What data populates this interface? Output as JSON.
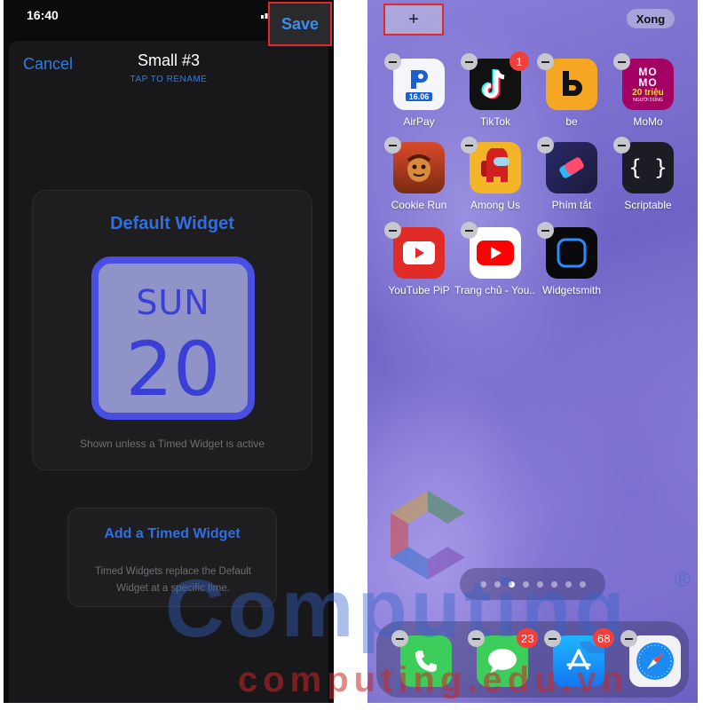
{
  "left": {
    "status": {
      "time": "16:40"
    },
    "nav": {
      "cancel": "Cancel",
      "title": "Small #3",
      "subtitle": "TAP TO RENAME",
      "save": "Save"
    },
    "default_card": {
      "title": "Default Widget",
      "day": "SUN",
      "date": "20",
      "caption": "Shown unless a Timed Widget is active"
    },
    "timed_card": {
      "title": "Add a Timed Widget",
      "description": "Timed Widgets replace the Default Widget at a specific time."
    }
  },
  "right": {
    "top": {
      "add": "+",
      "done": "Xong"
    },
    "apps": [
      {
        "label": "AirPay",
        "icon": "airpay-icon",
        "badge": ""
      },
      {
        "label": "TikTok",
        "icon": "tiktok-icon",
        "badge": "1"
      },
      {
        "label": "be",
        "icon": "be-icon",
        "badge": ""
      },
      {
        "label": "MoMo",
        "icon": "momo-icon",
        "badge": ""
      },
      {
        "label": "Cookie Run",
        "icon": "cookie-run-icon",
        "badge": ""
      },
      {
        "label": "Among Us",
        "icon": "among-us-icon",
        "badge": ""
      },
      {
        "label": "Phím tắt",
        "icon": "shortcuts-icon",
        "badge": ""
      },
      {
        "label": "Scriptable",
        "icon": "scriptable-icon",
        "badge": ""
      },
      {
        "label": "YouTube PiP",
        "icon": "youtube-pip-icon",
        "badge": ""
      },
      {
        "label": "Trang chủ - You...",
        "icon": "youtube-icon",
        "badge": ""
      },
      {
        "label": "Widgetsmith",
        "icon": "widgetsmith-icon",
        "badge": ""
      }
    ],
    "icon_text": {
      "airpay": "16.06",
      "momo_top": "MO",
      "momo_mid": "MO",
      "momo_promo": "20 triệu",
      "momo_sub": "NGƯỜI DÙNG",
      "scriptable": "{ }"
    },
    "page_dots": {
      "count": 8,
      "active_index": 2
    },
    "dock": [
      {
        "icon": "phone-icon",
        "badge": ""
      },
      {
        "icon": "messages-icon",
        "badge": "23"
      },
      {
        "icon": "app-store-icon",
        "badge": "68"
      },
      {
        "icon": "safari-icon",
        "badge": ""
      }
    ]
  },
  "watermark": {
    "main": "Computing",
    "sub": "computing.edu.vn",
    "reg": "®"
  },
  "colors": {
    "accent_blue": "#2f6ee3",
    "widget_purple": "#4a4fe3",
    "highlight_red": "#e02a2a"
  }
}
